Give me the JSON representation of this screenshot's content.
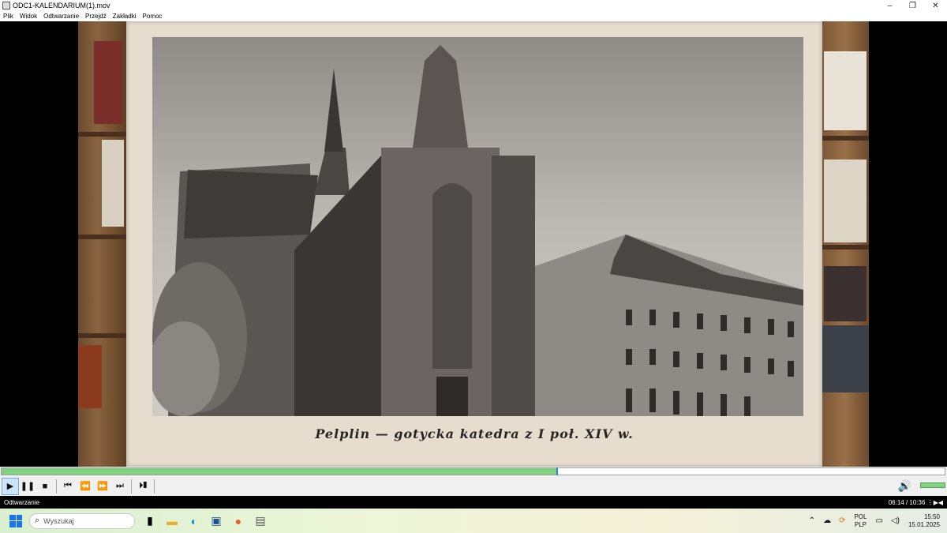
{
  "window": {
    "title": "ODC1-KALENDARIUM(1).mov",
    "controls": {
      "minimize": "–",
      "restore": "❐",
      "close": "✕"
    }
  },
  "menu": {
    "items": [
      "Plik",
      "Widok",
      "Odtwarzanie",
      "Przejdź",
      "Zakładki",
      "Pomoc"
    ]
  },
  "video": {
    "caption": "Pelplin — gotycka katedra z I poł. XIV w."
  },
  "playback": {
    "progress_fraction": 0.588,
    "buttons": {
      "play": "▶",
      "pause": "❚❚",
      "stop": "■",
      "prev": "⏮",
      "rewind": "⏪",
      "forward": "⏩",
      "next": "⏭",
      "frame_step": "⏵❚"
    },
    "volume_icon": "🔊"
  },
  "status": {
    "state": "Odtwarzanie",
    "time": "06:14 / 10:36"
  },
  "taskbar": {
    "search_placeholder": "Wyszukaj",
    "language_line1": "POL",
    "language_line2": "PLP",
    "time": "15:50",
    "date": "15.01.2025"
  },
  "colors": {
    "progress": "#7fd27f",
    "accent": "#1a73e8"
  }
}
